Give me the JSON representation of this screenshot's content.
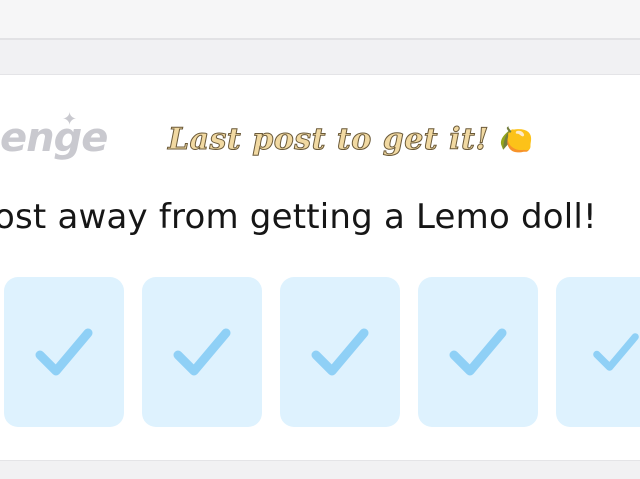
{
  "challenge": {
    "brand_text": "enge",
    "headline": "Last post to get it!",
    "headline_emoji": "🍋",
    "subtitle": "ost away from getting a Lemo doll!",
    "progress": {
      "completed": 5,
      "visible_tiles": 5
    },
    "tiles": [
      {
        "state": "checked",
        "icon": "checkmark-icon"
      },
      {
        "state": "checked",
        "icon": "checkmark-icon"
      },
      {
        "state": "checked",
        "icon": "checkmark-icon"
      },
      {
        "state": "checked",
        "icon": "checkmark-icon"
      },
      {
        "state": "checked",
        "icon": "checkmark-icon"
      }
    ],
    "colors": {
      "tile_bg": "#def2fe",
      "check": "#8fd0f6",
      "headline_fill": "#f1d9a2",
      "brand": "#c9c9cf"
    }
  }
}
